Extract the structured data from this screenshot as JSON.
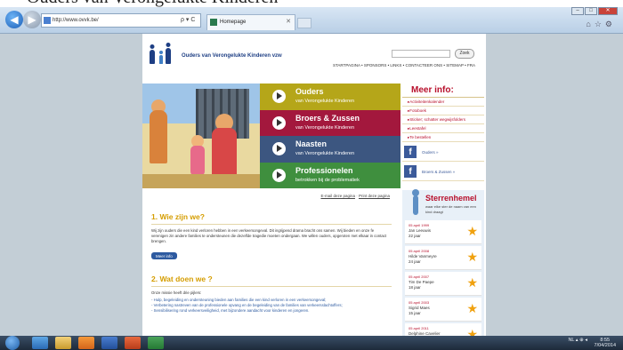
{
  "caption_cut": "Ouders van Verongelukte Kinderen",
  "browser": {
    "url": "http://www.ovvk.be/",
    "tab_title": "Homepage",
    "addr_tools": "ρ ▾ C"
  },
  "site": {
    "org_name": "Ouders van Verongelukte Kinderen vzw",
    "search_button": "Zoek",
    "topnav": "STARTPAGINA  •  SPONSORS  •  LINKS  •  CONTACTEER ONS  •  SITEMAP  •  FRA"
  },
  "hero": {
    "bands": [
      {
        "title": "Ouders",
        "subtitle": "van Verongelukte Kinderen"
      },
      {
        "title": "Broers & Zussen",
        "subtitle": "van Verongelukte Kinderen"
      },
      {
        "title": "Naasten",
        "subtitle": "van Verongelukte Kinderen"
      },
      {
        "title": "Professionelen",
        "subtitle": "betrokken bij de problematiek"
      }
    ]
  },
  "meer_info": {
    "title": "Meer info:",
    "links": [
      "Activiteitenkalender",
      "Fotoboek",
      "Sticker; schatter wegwijsfolders",
      "Leestafel",
      "Te bestellen"
    ],
    "facebook": [
      "Ouders »",
      "Broers & Zussen »"
    ]
  },
  "sterrenhemel": {
    "title": "Sterrenhemel",
    "subtitle": "waar elke ster de naam van een kind draagt",
    "items": [
      {
        "date": "05 april 1999",
        "name": "Jan Leeuwis",
        "age": "22 jaar"
      },
      {
        "date": "05 april 2008",
        "name": "Hilde Vanmeyre",
        "age": "24 jaar"
      },
      {
        "date": "05 april 2007",
        "name": "Tim De Paepe",
        "age": "18 jaar"
      },
      {
        "date": "05 april 2003",
        "name": "Sigrid Maes",
        "age": "15 jaar"
      },
      {
        "date": "05 april 2011",
        "name": "Delphine Cavelier",
        "age": ""
      }
    ]
  },
  "main": {
    "util_email": "E-mail deze pagina",
    "util_print": "Print deze pagina",
    "h1": "1. Wie zijn we?",
    "p1": "Wij zijn ouders die een kind verloren hebben in een verkeersongeval. Dit ingrijpend drama bracht ons samen. Wij bieden en onze fe verenigen zin andere families te ondersteunen die dezelfde tragedie moeten ondergaan. We willen ouders, opgeroten met elkaar in contact brengen.",
    "more": "Meer info",
    "h2": "2. Wat doen we ?",
    "p2_intro": "Onze missie heeft drie pijlers:",
    "p2_items": [
      "- Hulp, begeleiding en ondersteuning bieden aan families die een kind verloren in een verkeersongeval;",
      "- Verbetering nastreven van de professionele opvang en de begeleiding van de families van verkeersslachtoffers;",
      "- Sensibilisering rond verkeersveiligheid, met bijzondere aandacht voor kinderen en jongeren."
    ]
  },
  "taskbar": {
    "tray_text": "NL  ▴  ⊕  ◂",
    "time": "8:55",
    "date": "7/04/2014"
  }
}
